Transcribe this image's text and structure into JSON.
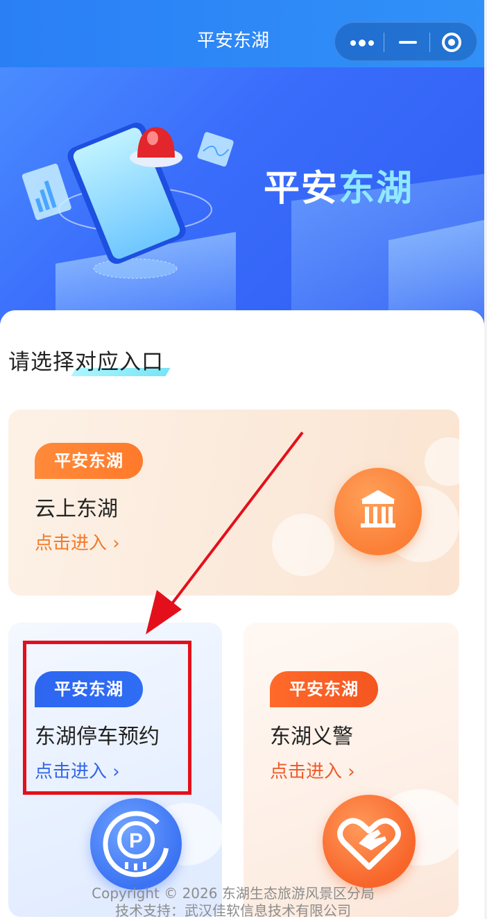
{
  "navbar": {
    "title": "平安东湖"
  },
  "banner": {
    "title_part1": "平安",
    "title_part2": "东湖"
  },
  "section": {
    "title": "请选择对应入口"
  },
  "cards": [
    {
      "tag": "平安东湖",
      "name": "云上东湖",
      "link": "点击进入",
      "icon": "pavilion-icon"
    },
    {
      "tag": "平安东湖",
      "name": "东湖停车预约",
      "link": "点击进入",
      "icon": "parking-icon"
    },
    {
      "tag": "平安东湖",
      "name": "东湖义警",
      "link": "点击进入",
      "icon": "heart-hand-icon"
    }
  ],
  "footer": {
    "copyright": "Copyright © 2026 东湖生态旅游风景区分局",
    "support": "技术支持：武汉佳软信息技术有限公司"
  },
  "colors": {
    "accent_blue": "#2f6df5",
    "accent_orange": "#ff7a2a",
    "annotation_red": "#e3101b"
  }
}
